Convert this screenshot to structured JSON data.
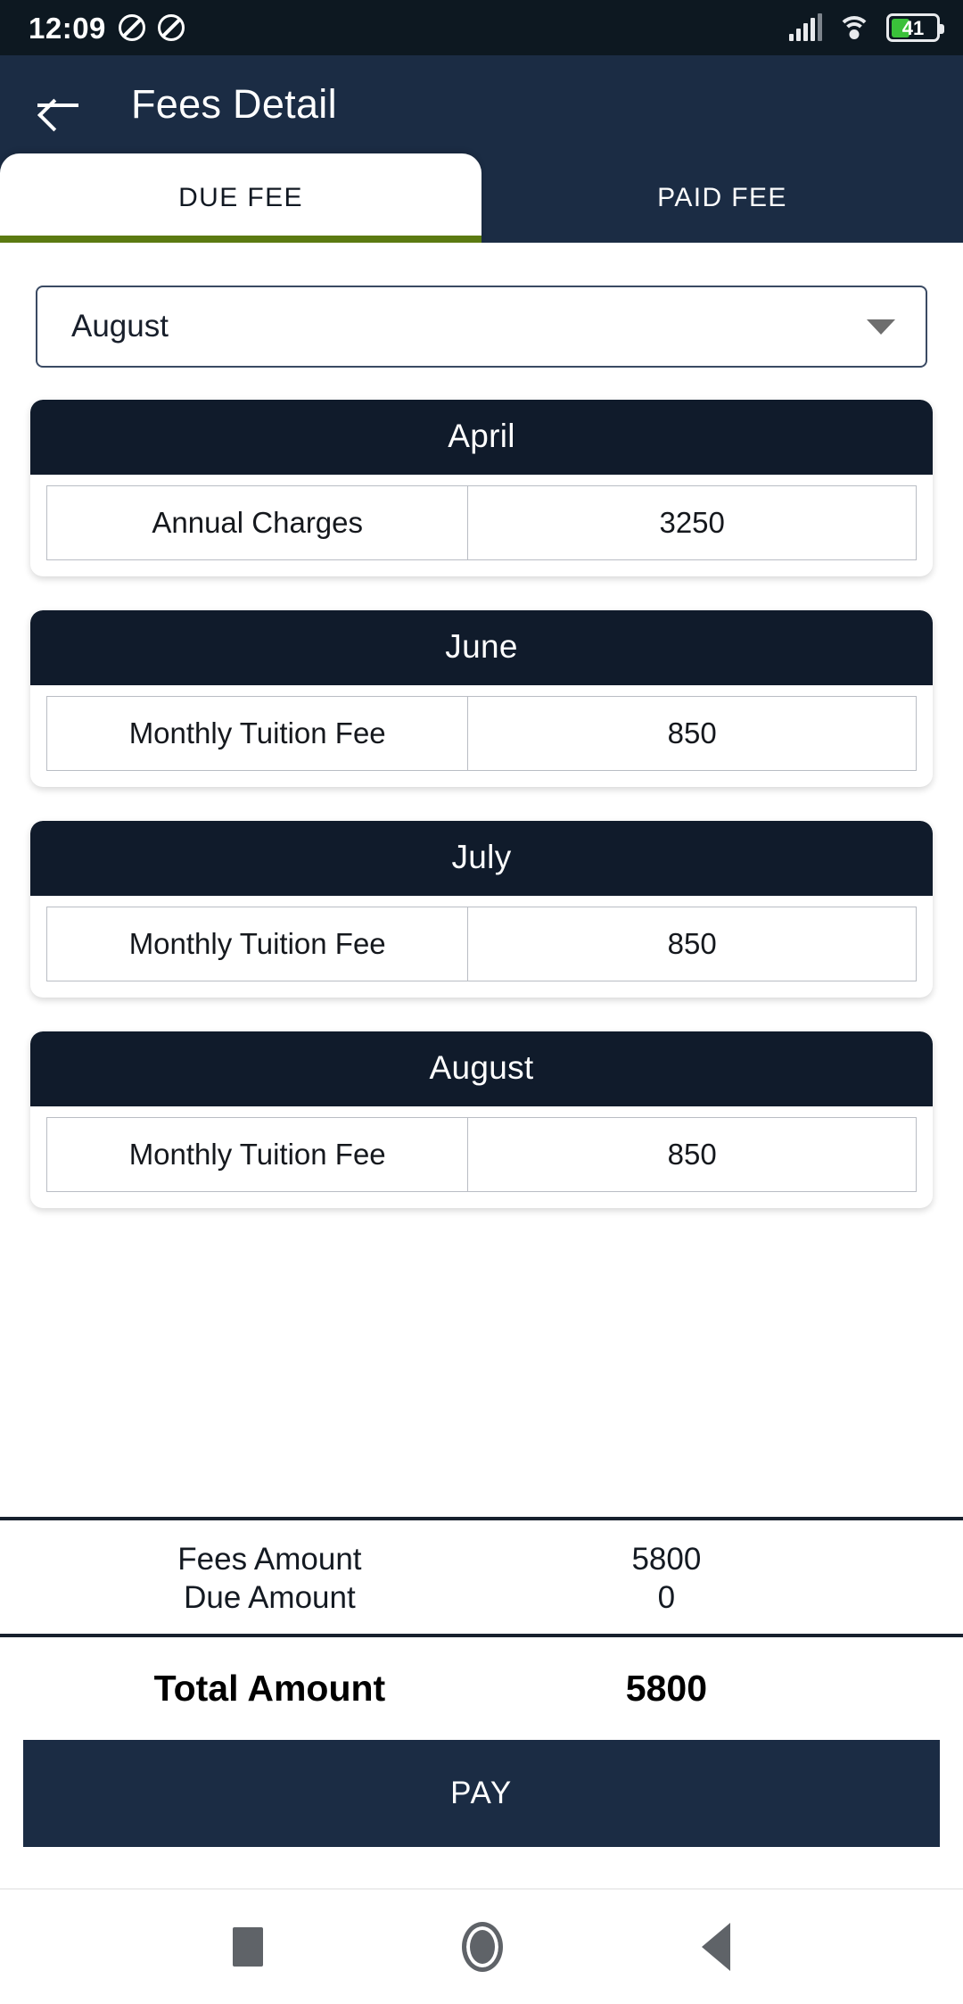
{
  "status_bar": {
    "time": "12:09",
    "icons_left": [
      "do-not-disturb-icon",
      "do-not-disturb-icon"
    ],
    "icons_right": [
      "cellular-signal-icon",
      "wifi-icon",
      "battery-icon"
    ],
    "battery_percent": "41",
    "battery_level": 41,
    "battery_color": "#3ac13a",
    "background": "#0d1821"
  },
  "app_bar": {
    "back_icon": "back-arrow-icon",
    "title": "Fees Detail",
    "background": "#1b2c44"
  },
  "tabs": {
    "items": [
      {
        "label": "DUE FEE",
        "active": true
      },
      {
        "label": "PAID FEE",
        "active": false
      }
    ],
    "indicator_color": "#5b7a11"
  },
  "month_filter": {
    "selected": "August",
    "caret_icon": "chevron-down-icon",
    "options": [
      "April",
      "June",
      "July",
      "August"
    ]
  },
  "fee_cards": [
    {
      "month": "April",
      "rows": [
        {
          "label": "Annual Charges",
          "value": "3250"
        }
      ]
    },
    {
      "month": "June",
      "rows": [
        {
          "label": "Monthly Tuition Fee",
          "value": "850"
        }
      ]
    },
    {
      "month": "July",
      "rows": [
        {
          "label": "Monthly Tuition Fee",
          "value": "850"
        }
      ]
    },
    {
      "month": "August",
      "rows": [
        {
          "label": "Monthly Tuition Fee",
          "value": "850"
        }
      ]
    }
  ],
  "summary": {
    "fees_amount_label": "Fees Amount",
    "fees_amount_value": "5800",
    "due_amount_label": "Due Amount",
    "due_amount_value": "0",
    "total_label": "Total Amount",
    "total_value": "5800"
  },
  "pay_button": {
    "label": "PAY",
    "background": "#1b2c44"
  },
  "nav_bar": {
    "items": [
      "recents-square-icon",
      "home-circle-icon",
      "back-triangle-icon"
    ]
  }
}
